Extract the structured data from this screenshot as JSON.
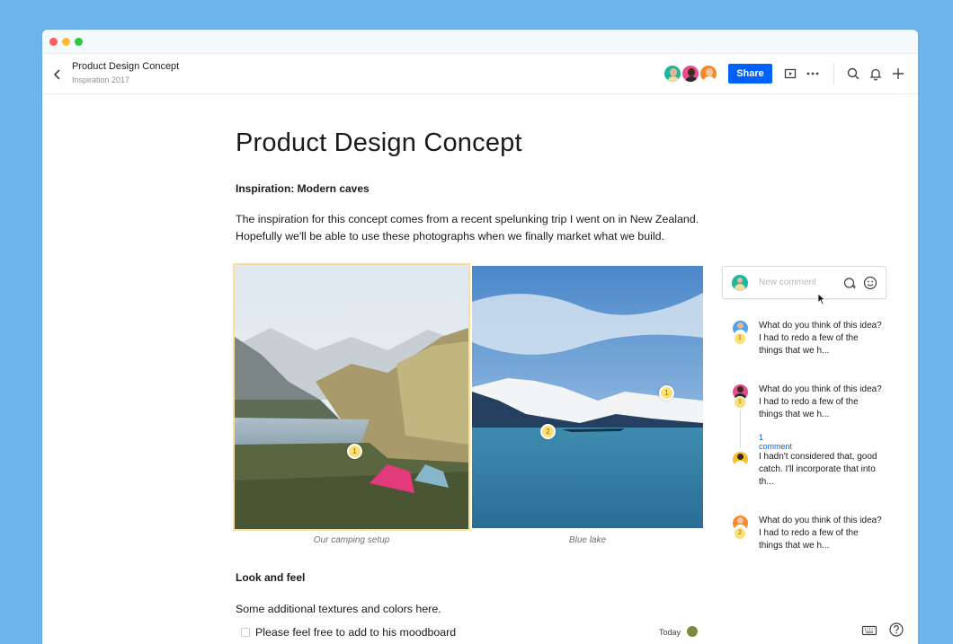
{
  "window": {
    "controls": [
      "close",
      "minimize",
      "zoom"
    ]
  },
  "toolbar": {
    "title": "Product Design Concept",
    "subtitle": "Inspiration 2017",
    "share_label": "Share",
    "avatar_colors": [
      "#1bb89f",
      "#e84d8a",
      "#f7892a"
    ],
    "icons": [
      "back-chevron-icon",
      "present-icon",
      "more-icon",
      "search-icon",
      "bell-icon",
      "plus-icon"
    ]
  },
  "document": {
    "heading": "Product Design Concept",
    "section1": "Inspiration: Modern caves",
    "paragraph": "The inspiration for this concept comes from a recent spelunking trip I went on in New Zealand. Hopefully we'll be able to use these photographs when we finally market what we build.",
    "photos": [
      {
        "caption": "Our camping setup",
        "pins": [
          "1"
        ]
      },
      {
        "caption": "Blue lake",
        "pins": [
          "1",
          "2"
        ]
      }
    ],
    "section2": "Look and feel",
    "paragraph2": "Some additional textures and colors here.",
    "todo": {
      "text": "Please feel free to add to his moodboard",
      "checked": false,
      "date": "Today"
    }
  },
  "comments": {
    "placeholder": "New comment",
    "threads": [
      {
        "avatar_color": "#4ea3f0",
        "pin": "1",
        "text": "What do you think of this idea? I had to redo a few of the things that we h..."
      },
      {
        "avatar_color": "#e84d8a",
        "pin": "1",
        "text": "What do you think of this idea? I had to redo a few of the things that we h...",
        "link": "1 comment",
        "reply": "I hadn't considered that, good catch. I'll incorporate that into th..."
      },
      {
        "avatar_color": "#f7892a",
        "pin": "2",
        "text": "What do you think of this idea? I had to redo a few of the things that we h..."
      }
    ]
  },
  "footer": {
    "icons": [
      "keyboard-icon",
      "help-icon"
    ]
  }
}
